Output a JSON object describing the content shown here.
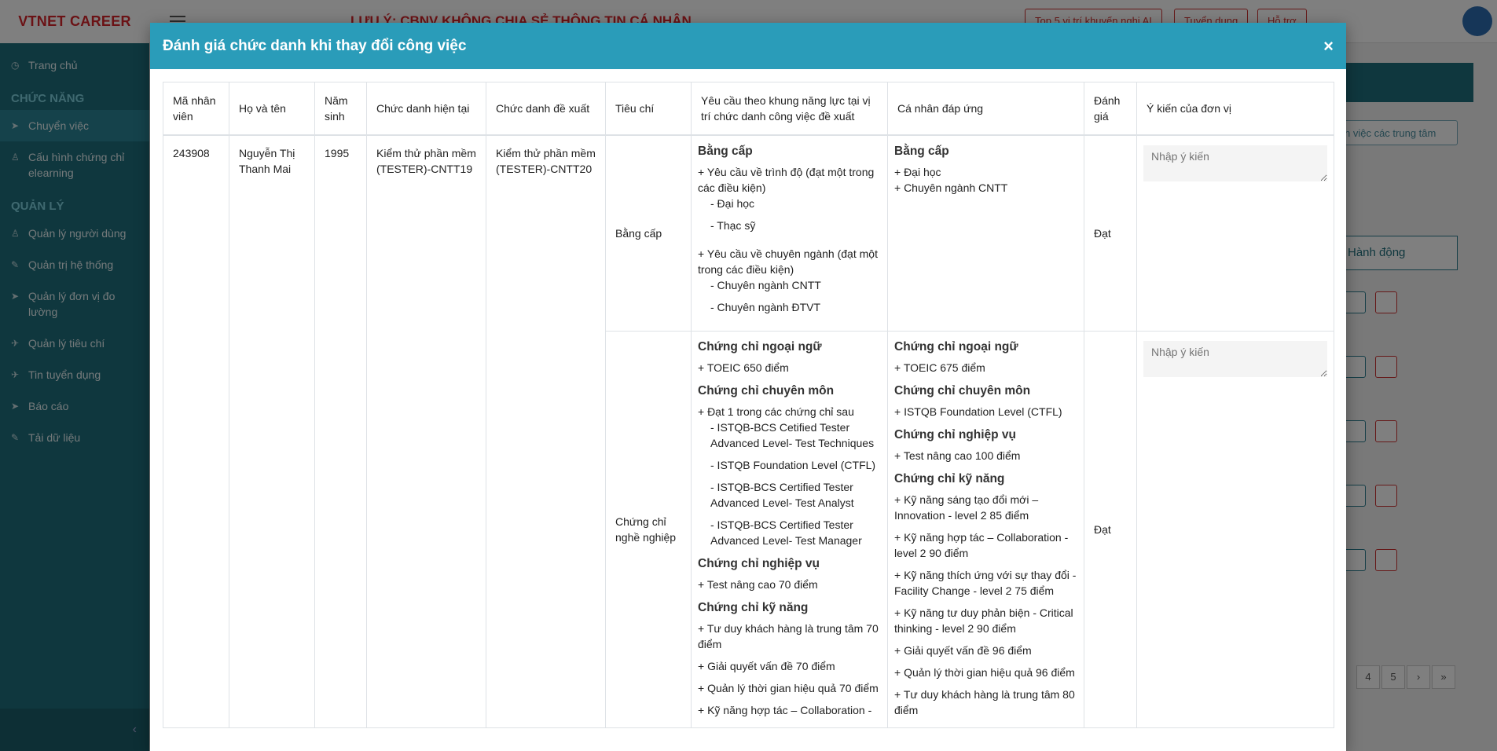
{
  "app": {
    "brand": "VTNET CAREER",
    "notice": "LƯU Ý: CBNV KHÔNG CHIA SẺ THÔNG TIN CÁ NHÂN",
    "top_buttons": [
      "Top 5 vị trí khuyến nghị AI",
      "Tuyển dụng",
      "Hỗ trợ"
    ]
  },
  "sidebar": {
    "home": "Trang chủ",
    "section_functions": "CHỨC NĂNG",
    "functions": [
      "Chuyển việc",
      "Cấu hình chứng chỉ elearning"
    ],
    "section_manage": "QUẢN LÝ",
    "manage": [
      "Quản lý người dùng",
      "Quản trị hệ thống",
      "Quản lý đơn vị đo lường",
      "Quản lý tiêu chí",
      "Tin tuyển dụng",
      "Báo cáo",
      "Tải dữ liệu"
    ]
  },
  "background": {
    "chip": "n việc các trung tâm",
    "column_action": "Hành động",
    "pages": [
      "4",
      "5",
      "›",
      "»"
    ]
  },
  "modal": {
    "title": "Đánh giá chức danh khi thay đổi công việc",
    "close": "×",
    "columns": [
      "Mã nhân viên",
      "Họ và tên",
      "Năm sinh",
      "Chức danh hiện tại",
      "Chức danh đề xuất",
      "Tiêu chí",
      "Yêu cầu theo khung năng lực tại vị trí chức danh công việc đề xuất",
      "Cá nhân đáp ứng",
      "Đánh giá",
      "Ý kiến của đơn vị"
    ],
    "employee": {
      "id": "243908",
      "name": "Nguyễn Thị Thanh Mai",
      "birth_year": "1995",
      "current_title": "Kiểm thử phần mềm (TESTER)-CNTT19",
      "proposed_title": "Kiểm thử phần mềm (TESTER)-CNTT20"
    },
    "opinion_placeholder": "Nhập ý kiến",
    "criteria": [
      {
        "name": "Bằng cấp",
        "result": "Đạt",
        "requirement": {
          "title": "Bằng cấp",
          "req1": "+ Yêu cầu về trình độ (đạt một trong các điều kiện)",
          "req1_items": [
            "- Đại học",
            "- Thạc sỹ"
          ],
          "req2": "+ Yêu cầu về chuyên ngành (đạt một trong các điều kiện)",
          "req2_items": [
            "- Chuyên ngành CNTT",
            "- Chuyên ngành ĐTVT"
          ]
        },
        "meets": {
          "title": "Bằng cấp",
          "items": [
            "+ Đại học",
            "+ Chuyên ngành CNTT"
          ]
        }
      },
      {
        "name": "Chứng chỉ nghề nghiệp",
        "result": "Đạt",
        "requirement": {
          "lang_title": "Chứng chỉ ngoại ngữ",
          "lang_item": "+ TOEIC 650 điểm",
          "pro_title": "Chứng chỉ chuyên môn",
          "pro_item": "+ Đạt 1 trong các chứng chỉ sau",
          "pro_sub": [
            "- ISTQB-BCS Cetified Tester Advanced Level- Test Techniques",
            "- ISTQB Foundation Level (CTFL)",
            "- ISTQB-BCS Certified Tester Advanced Level- Test Analyst",
            "- ISTQB-BCS Certified Tester Advanced Level- Test Manager"
          ],
          "biz_title": "Chứng chỉ nghiệp vụ",
          "biz_item": "+ Test nâng cao 70 điểm",
          "skill_title": "Chứng chỉ kỹ năng",
          "skill_items": [
            "+ Tư duy khách hàng là trung tâm 70 điểm",
            "+ Giải quyết vấn đề 70 điểm",
            "+ Quản lý thời gian hiệu quả 70 điểm",
            "+ Kỹ năng hợp tác – Collaboration -"
          ]
        },
        "meets": {
          "lang_title": "Chứng chỉ ngoại ngữ",
          "lang_item": "+ TOEIC 675 điểm",
          "pro_title": "Chứng chỉ chuyên môn",
          "pro_item": "+ ISTQB Foundation Level (CTFL)",
          "biz_title": "Chứng chỉ nghiệp vụ",
          "biz_item": "+ Test nâng cao 100 điểm",
          "skill_title": "Chứng chỉ kỹ năng",
          "skill_items": [
            "+ Kỹ năng sáng tạo đổi mới – Innovation - level 2 85 điểm",
            "+ Kỹ năng hợp tác – Collaboration - level 2 90 điểm",
            "+ Kỹ năng thích ứng với sự thay đổi - Facility Change - level 2 75 điểm",
            "+ Kỹ năng tư duy phản biện - Critical thinking - level 2 90 điểm",
            "+ Giải quyết vấn đề 96 điểm",
            "+ Quản lý thời gian hiệu quả 96 điểm",
            "+ Tư duy khách hàng là trung tâm 80 điểm"
          ]
        }
      }
    ]
  }
}
